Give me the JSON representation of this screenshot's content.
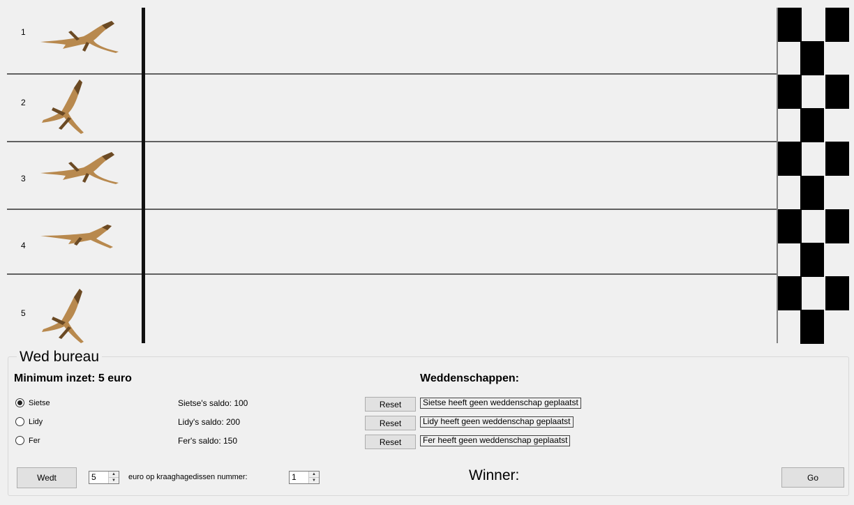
{
  "lanes": [
    {
      "number": "1",
      "pose": "run"
    },
    {
      "number": "2",
      "pose": "up"
    },
    {
      "number": "3",
      "pose": "run"
    },
    {
      "number": "4",
      "pose": "flat"
    },
    {
      "number": "5",
      "pose": "up"
    }
  ],
  "colors": {
    "lizard": "#b8894e",
    "lizard_dark": "#6b4a24",
    "finish": "#000000"
  },
  "betting": {
    "group_title": "Wed bureau",
    "minimum_label": "Minimum inzet: 5 euro",
    "bets_heading": "Weddenschappen:",
    "players": [
      {
        "name": "Sietse",
        "checked": true,
        "saldo": "Sietse's saldo: 100",
        "reset": "Reset",
        "bet_status": "Sietse heeft geen weddenschap geplaatst"
      },
      {
        "name": "Lidy",
        "checked": false,
        "saldo": "Lidy's saldo: 200",
        "reset": "Reset",
        "bet_status": "Lidy heeft geen weddenschap geplaatst"
      },
      {
        "name": "Fer",
        "checked": false,
        "saldo": "Fer's saldo: 150",
        "reset": "Reset",
        "bet_status": "Fer heeft geen weddenschap geplaatst"
      }
    ],
    "wedt_label": "Wedt",
    "amount_value": "5",
    "amount_text": "euro op kraaghagedissen nummer:",
    "lizard_number_value": "1",
    "winner_label": "Winner:",
    "go_label": "Go"
  }
}
